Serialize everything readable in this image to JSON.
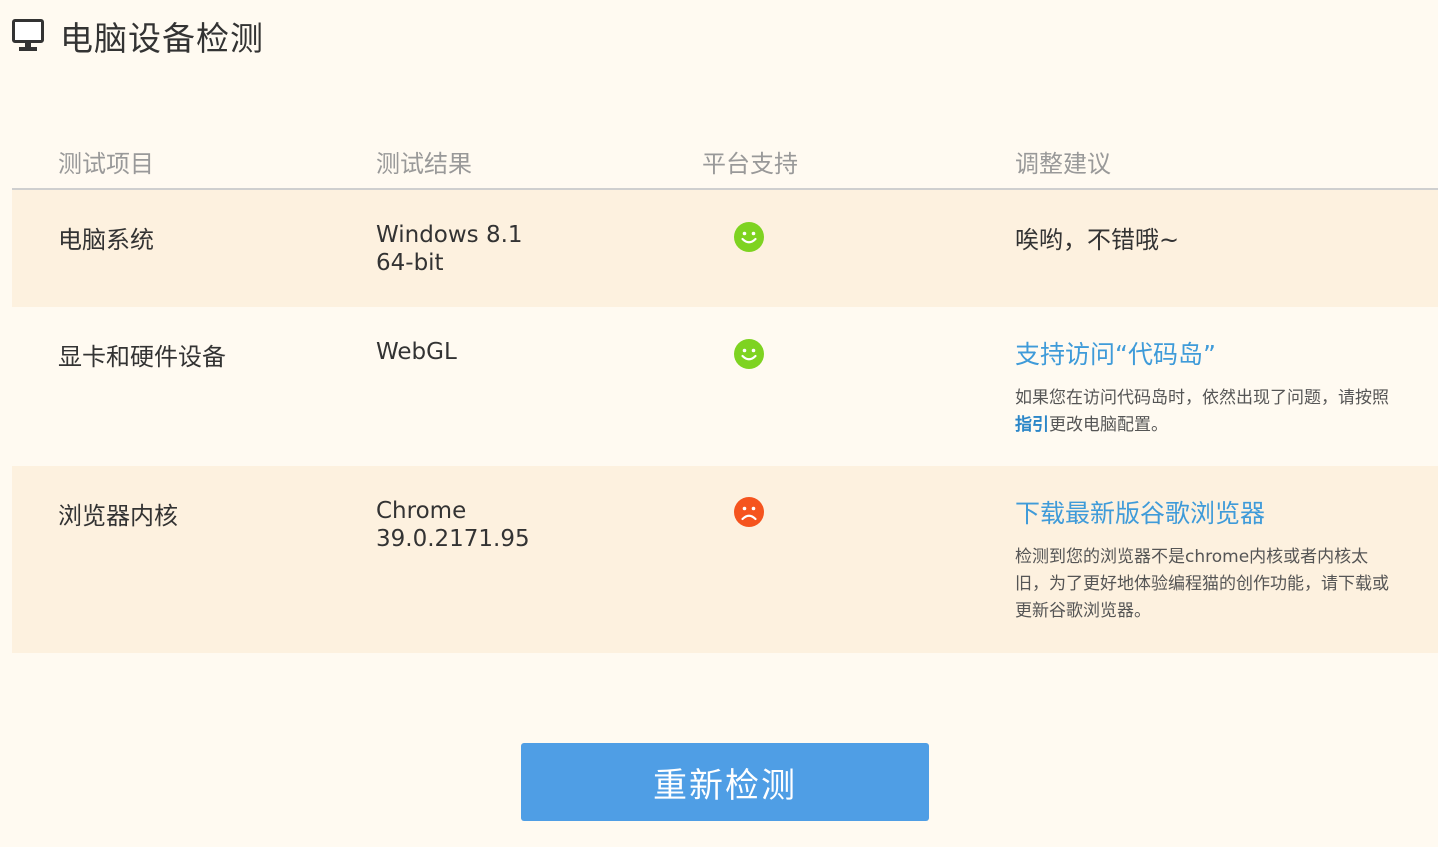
{
  "page": {
    "title": "电脑设备检测"
  },
  "table": {
    "headers": {
      "item": "测试项目",
      "result": "测试结果",
      "support": "平台支持",
      "advice": "调整建议"
    },
    "rows": [
      {
        "item": "电脑系统",
        "result": "Windows 8.1 64-bit",
        "supported": true,
        "advice": "唉哟，不错哦~"
      },
      {
        "item": "显卡和硬件设备",
        "result": "WebGL",
        "supported": true,
        "advice_link": "支持访问“代码岛”",
        "desc_before": "如果您在访问代码岛时，依然出现了问题，请按照",
        "desc_link": "指引",
        "desc_after": "更改电脑配置。"
      },
      {
        "item": "浏览器内核",
        "result": "Chrome 39.0.2171.95",
        "supported": false,
        "advice_link": "下载最新版谷歌浏览器",
        "desc": "检测到您的浏览器不是chrome内核或者内核太旧，为了更好地体验编程猫的创作功能，请下载或更新谷歌浏览器。"
      }
    ]
  },
  "recheck_button": {
    "label": "重新检测"
  },
  "colors": {
    "background": "#fffaf1",
    "row_alt": "#fdf1df",
    "link": "#3f9bd9",
    "ok_face": "#7ed321",
    "fail_face": "#f5541e",
    "button": "#4f9ee5"
  },
  "icons": {
    "header": "monitor-icon",
    "supported": "smile-icon",
    "unsupported": "sad-icon"
  }
}
